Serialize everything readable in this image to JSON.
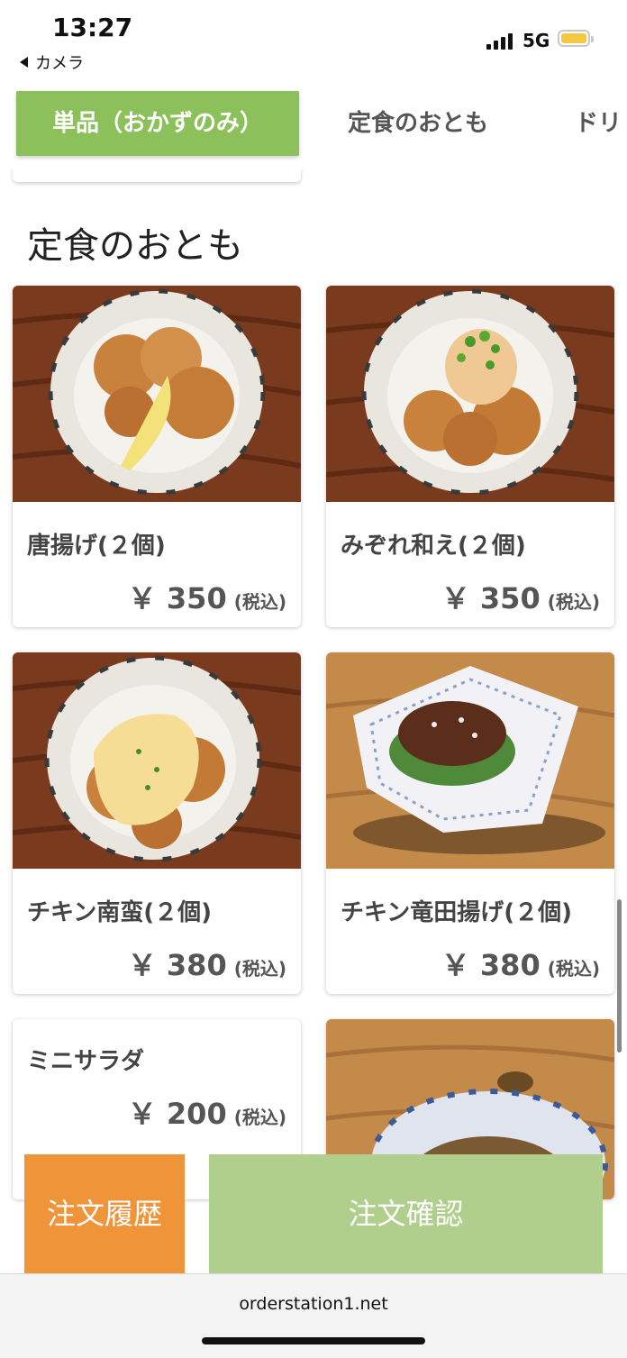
{
  "status_bar": {
    "time": "13:27",
    "back_label": "カメラ",
    "network": "5G"
  },
  "tabs": [
    {
      "label": "単品（おかずのみ）",
      "active": true
    },
    {
      "label": "定食のおとも",
      "active": false
    },
    {
      "label": "ドリ",
      "active": false
    }
  ],
  "section": {
    "title": "定食のおとも"
  },
  "items": [
    {
      "name": "唐揚げ(２個)",
      "price": "￥ 350",
      "tax": "(税込)"
    },
    {
      "name": "みぞれ和え(２個)",
      "price": "￥ 350",
      "tax": "(税込)"
    },
    {
      "name": "チキン南蛮(２個)",
      "price": "￥ 380",
      "tax": "(税込)"
    },
    {
      "name": "チキン竜田揚げ(２個)",
      "price": "￥ 380",
      "tax": "(税込)"
    },
    {
      "name": "ミニサラダ",
      "price": "￥ 200",
      "tax": "(税込)"
    }
  ],
  "actions": {
    "history": "注文履歴",
    "confirm": "注文確認"
  },
  "browser": {
    "url": "orderstation1.net"
  },
  "colors": {
    "accent_green": "#8cc05a",
    "history_orange": "#f0943a",
    "confirm_green": "#b0cf8c"
  }
}
